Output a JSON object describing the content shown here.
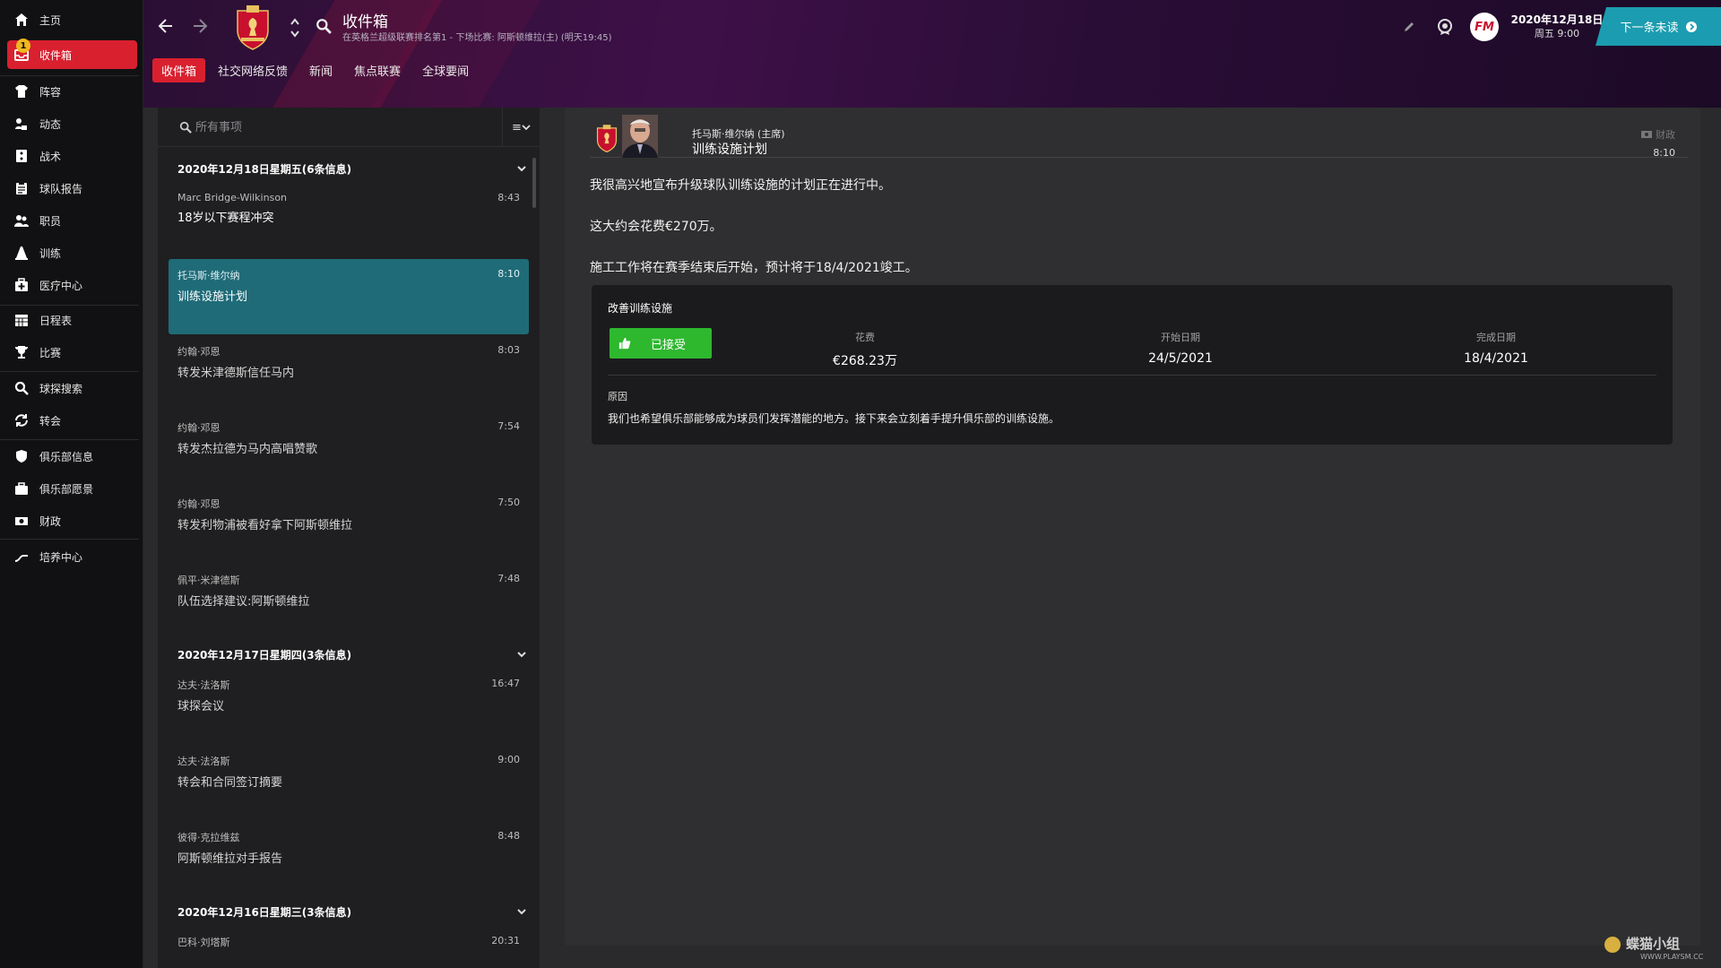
{
  "sidebar": {
    "items": [
      {
        "label": "主页",
        "icon": "home-icon"
      },
      {
        "label": "收件箱",
        "icon": "inbox-icon",
        "badge": "1",
        "active": true
      },
      {
        "label": "阵容",
        "icon": "shirt-icon"
      },
      {
        "label": "动态",
        "icon": "dynamics-icon"
      },
      {
        "label": "战术",
        "icon": "tactics-icon"
      },
      {
        "label": "球队报告",
        "icon": "clipboard-icon"
      },
      {
        "label": "职员",
        "icon": "staff-icon"
      },
      {
        "label": "训练",
        "icon": "cone-icon"
      },
      {
        "label": "医疗中心",
        "icon": "medical-icon"
      },
      {
        "label": "日程表",
        "icon": "calendar-icon"
      },
      {
        "label": "比赛",
        "icon": "trophy-icon"
      },
      {
        "label": "球探搜索",
        "icon": "search-icon"
      },
      {
        "label": "转会",
        "icon": "transfer-icon"
      },
      {
        "label": "俱乐部信息",
        "icon": "shield-icon"
      },
      {
        "label": "俱乐部愿景",
        "icon": "vision-icon"
      },
      {
        "label": "财政",
        "icon": "money-icon"
      },
      {
        "label": "培养中心",
        "icon": "development-icon"
      }
    ]
  },
  "header": {
    "title": "收件箱",
    "subtitle": "在英格兰超级联赛排名第1 - 下场比赛: 阿斯顿维拉(主) (明天19:45)",
    "tabs": [
      "收件箱",
      "社交网络反馈",
      "新闻",
      "焦点联赛",
      "全球要闻"
    ],
    "date": "2020年12月18日",
    "day_time": "周五 9:00",
    "next_unread": "下一条未读",
    "fm_logo": "FM"
  },
  "inbox": {
    "search_placeholder": "所有事项",
    "sort_label": "≡",
    "groups": [
      {
        "header": "2020年12月18日星期五(6条信息)"
      },
      {
        "header": "2020年12月17日星期四(3条信息)"
      },
      {
        "header": "2020年12月16日星期三(3条信息)"
      }
    ],
    "messages": [
      {
        "from": "Marc Bridge-Wilkinson",
        "time": "8:43",
        "subject": "18岁以下赛程冲突"
      },
      {
        "from": "托马斯·维尔纳",
        "time": "8:10",
        "subject": "训练设施计划"
      },
      {
        "from": "约翰·邓恩",
        "time": "8:03",
        "subject": "转发米津德斯信任马内"
      },
      {
        "from": "约翰·邓恩",
        "time": "7:54",
        "subject": "转发杰拉德为马内高唱赞歌"
      },
      {
        "from": "约翰·邓恩",
        "time": "7:50",
        "subject": "转发利物浦被看好拿下阿斯顿维拉"
      },
      {
        "from": "佩平·米津德斯",
        "time": "7:48",
        "subject": "队伍选择建议:阿斯顿维拉"
      },
      {
        "from": "达夫·法洛斯",
        "time": "16:47",
        "subject": "球探会议"
      },
      {
        "from": "达夫·法洛斯",
        "time": "9:00",
        "subject": "转会和合同签订摘要"
      },
      {
        "from": "彼得·克拉维兹",
        "time": "8:48",
        "subject": "阿斯顿维拉对手报告"
      },
      {
        "from": "巴科·刘塔斯",
        "time": "20:31",
        "subject": ""
      }
    ]
  },
  "detail": {
    "sender": "托马斯·维尔纳 (主席)",
    "title": "训练设施计划",
    "tag": "财政",
    "time": "8:10",
    "paragraphs": [
      "我很高兴地宣布升级球队训练设施的计划正在进行中。",
      "这大约会花费€270万。",
      "施工工作将在赛季结束后开始，预计将于18/4/2021竣工。"
    ],
    "card": {
      "title": "改善训练设施",
      "accepted": "已接受",
      "cost_label": "花费",
      "cost_value": "€268.23万",
      "start_label": "开始日期",
      "start_value": "24/5/2021",
      "end_label": "完成日期",
      "end_value": "18/4/2021",
      "reason_label": "原因",
      "reason_text": "我们也希望俱乐部能够成为球员们发挥潜能的地方。接下来会立刻着手提升俱乐部的训练设施。"
    }
  },
  "watermark": {
    "text": "蝶猫小组",
    "site": "WWW.PLAYSM.CC"
  },
  "colors": {
    "accent_red": "#d9202f",
    "selected_teal": "#1f6b78",
    "accept_green": "#2eb82e",
    "next_btn": "#1c9cb0"
  }
}
